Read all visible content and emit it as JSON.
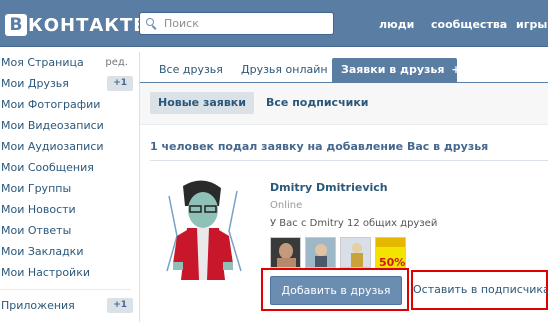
{
  "header": {
    "logo_letter": "В",
    "logo_text": "КОНТАКТЕ",
    "search_placeholder": "Поиск",
    "nav": [
      "люди",
      "сообщества",
      "игры"
    ],
    "color": "#597da3"
  },
  "sidebar": {
    "items": [
      {
        "label": "Моя Страница",
        "extra": "ред."
      },
      {
        "label": "Мои Друзья",
        "badge": "+1"
      },
      {
        "label": "Мои Фотографии"
      },
      {
        "label": "Мои Видеозаписи"
      },
      {
        "label": "Мои Аудиозаписи"
      },
      {
        "label": "Мои Сообщения"
      },
      {
        "label": "Мои Группы"
      },
      {
        "label": "Мои Новости"
      },
      {
        "label": "Мои Ответы"
      },
      {
        "label": "Мои Закладки"
      },
      {
        "label": "Мои Настройки"
      }
    ],
    "apps": {
      "label": "Приложения",
      "badge": "+1"
    }
  },
  "tabs": [
    {
      "label": "Все друзья"
    },
    {
      "label": "Друзья онлайн"
    },
    {
      "label": "Заявки в друзья",
      "count": "+1",
      "active": true
    }
  ],
  "subtabs": [
    {
      "label": "Новые заявки",
      "active": true
    },
    {
      "label": "Все подписчики"
    }
  ],
  "requests": {
    "header": "1 человек подал заявку на добавление Вас в друзья",
    "friend": {
      "name": "Dmitry Dmitrievich",
      "status": "Online",
      "mutual_text": "У Вас с Dmitry 12 общих друзей",
      "thumb_text": "50%"
    },
    "add_button": "Добавить в друзья",
    "leave_link": "Оставить в подписчиках"
  }
}
